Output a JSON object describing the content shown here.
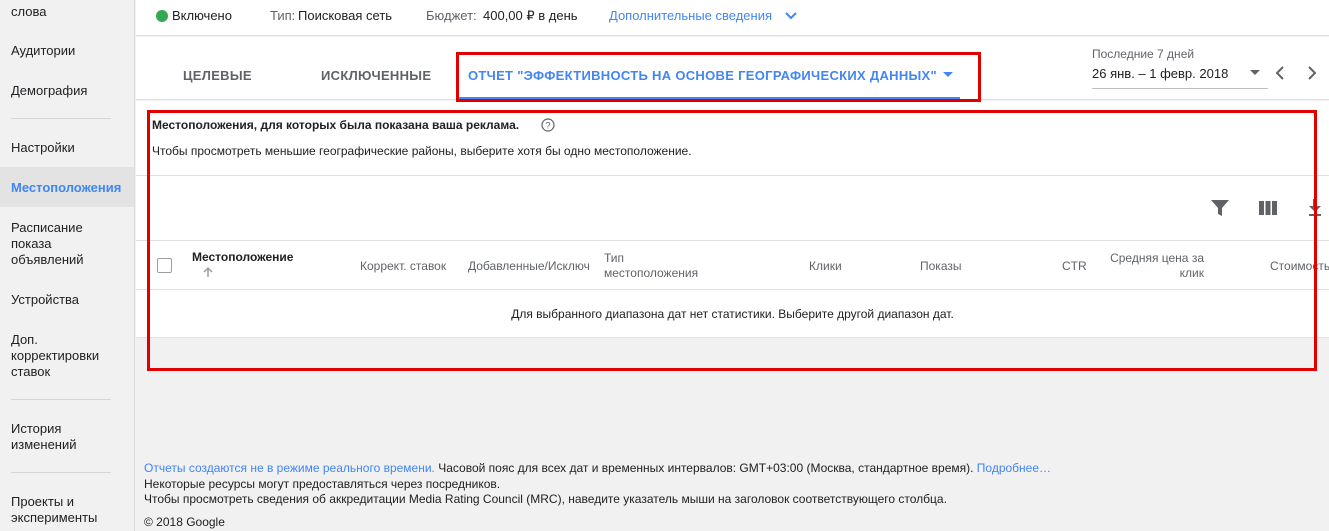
{
  "sidebar": {
    "items": [
      {
        "label": "слова"
      },
      {
        "label": "Аудитории"
      },
      {
        "label": "Демография"
      },
      {
        "label": "Настройки"
      },
      {
        "label": "Местоположения"
      },
      {
        "label": "Расписание показа объявлений"
      },
      {
        "label": "Устройства"
      },
      {
        "label": "Доп. корректировки ставок"
      },
      {
        "label": "История изменений"
      },
      {
        "label": "Проекты и эксперименты"
      }
    ]
  },
  "status": {
    "state": "Включено",
    "type_label": "Тип:",
    "type_value": "Поисковая сеть",
    "budget_label": "Бюджет:",
    "budget_value": "400,00 ₽ в день",
    "more_details": "Дополнительные сведения"
  },
  "tabs": [
    {
      "label": "ЦЕЛЕВЫЕ"
    },
    {
      "label": "ИСКЛЮЧЕННЫЕ"
    },
    {
      "label": "ОТЧЕТ \"ЭФФЕКТИВНОСТЬ НА ОСНОВЕ ГЕОГРАФИЧЕСКИХ ДАННЫХ\""
    }
  ],
  "date_range": {
    "label": "Последние 7 дней",
    "value": "26 янв. – 1 февр. 2018"
  },
  "section": {
    "title": "Местоположения, для которых была показана ваша реклама.",
    "hint": "Чтобы просмотреть меньшие географические районы, выберите хотя бы одно местоположение."
  },
  "table": {
    "headers": [
      "Местоположение",
      "Коррект. ставок",
      "Добавленные/Исключ",
      "Тип местоположения",
      "Клики",
      "Показы",
      "CTR",
      "Средняя цена за клик",
      "Стоимость"
    ],
    "empty_message": "Для выбранного диапазона дат нет статистики. Выберите другой диапазон дат."
  },
  "footer": {
    "link1": "Отчеты создаются не в режиме реального времени.",
    "text1": " Часовой пояс для всех дат и временных интервалов: GMT+03:00 (Москва, стандартное время). ",
    "link2": "Подробнее…",
    "line2": "Некоторые ресурсы могут предоставляться через посредников.",
    "line3": "Чтобы просмотреть сведения об аккредитации Media Rating Council (MRC), наведите указатель мыши на заголовок соответствующего столбца.",
    "copyright": "© 2018 Google"
  },
  "colors": {
    "accent": "#4285f4",
    "status_green": "#34a853",
    "highlight_red": "#e00000"
  }
}
